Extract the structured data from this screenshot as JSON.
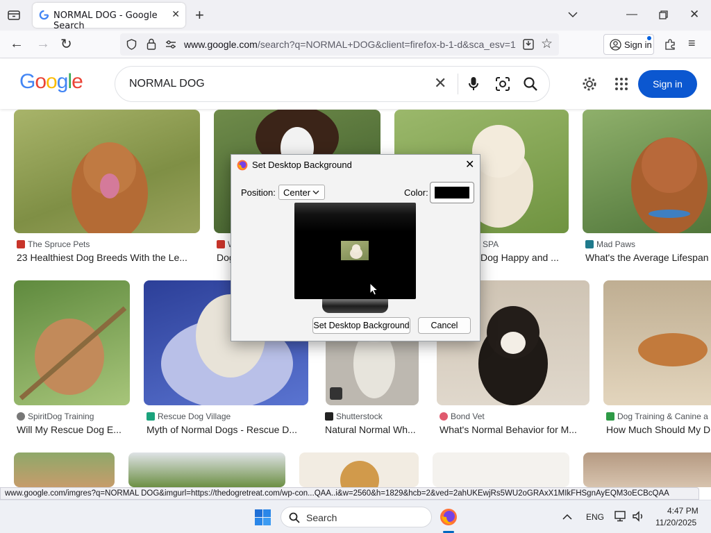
{
  "browser": {
    "tab_title": "NORMAL DOG - Google Search",
    "url_domain": "www.google.com",
    "url_rest": "/search?q=NORMAL+DOG&client=firefox-b-1-d&sca_esv=1",
    "signin_label": "Sign in"
  },
  "google": {
    "logo": "Google",
    "query": "NORMAL DOG",
    "signin_label": "Sign in"
  },
  "results": [
    {
      "source": "The Spruce Pets",
      "caption": "23 Healthiest Dog Breeds With the Le..."
    },
    {
      "source": "W",
      "caption": "Dog"
    },
    {
      "source": "SPA",
      "caption": "Dog Happy and ..."
    },
    {
      "source": "Mad Paws",
      "caption": "What's the Average Lifespan"
    },
    {
      "source": "SpiritDog Training",
      "caption": "Will My Rescue Dog E..."
    },
    {
      "source": "Rescue Dog Village",
      "caption": "Myth of Normal Dogs - Rescue D..."
    },
    {
      "source": "Shutterstock",
      "caption": "Natural Normal Wh..."
    },
    {
      "source": "Bond Vet",
      "caption": "What's Normal Behavior for M..."
    },
    {
      "source": "Dog Training & Canine a",
      "caption": "How Much Should My D"
    }
  ],
  "status_url": "www.google.com/imgres?q=NORMAL DOG&imgurl=https://thedogretreat.com/wp-con...QAA..i&w=2560&h=1829&hcb=2&ved=2ahUKEwjRs5WU2oGRAxX1MIkFHSgnAyEQM3oECBcQAA",
  "dialog": {
    "title": "Set Desktop Background",
    "position_label": "Position:",
    "position_value": "Center",
    "color_label": "Color:",
    "color_value": "#000000",
    "set_button": "Set Desktop Background",
    "cancel_button": "Cancel"
  },
  "taskbar": {
    "search_placeholder": "Search",
    "language": "ENG",
    "time": "4:47 PM",
    "date": "11/20/2025"
  },
  "colors": {
    "google_blue": "#4285F4",
    "google_red": "#EA4335",
    "google_yellow": "#FBBC05",
    "google_green": "#34A853",
    "signin_blue": "#0b57d0"
  }
}
